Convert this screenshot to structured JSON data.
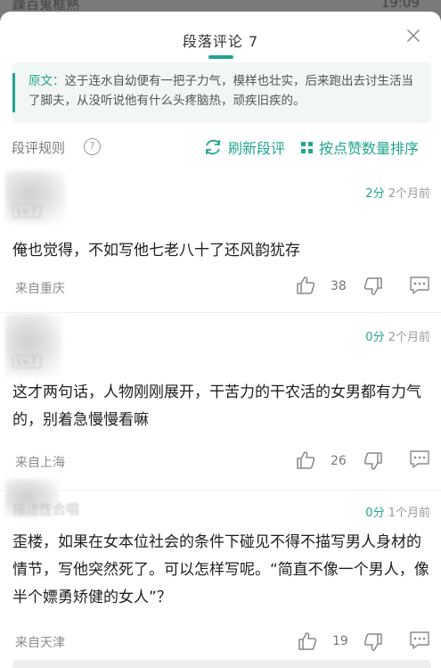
{
  "status_bar": {
    "left_text": "躁百鬼框熟",
    "time": "19:09"
  },
  "header": {
    "title": "段落评论  7",
    "close_label": "×"
  },
  "quote": {
    "label": "原文：",
    "text": "这于连水自幼便有一把子力气，模样也壮实，后来跑出去讨生活当了脚夫，从没听说他有什么头疼脑热，顽疾旧疾的。"
  },
  "toolbar": {
    "rules_label": "段评规则",
    "help_label": "?",
    "refresh_label": "刷新段评",
    "sort_label": "按点赞数量排序"
  },
  "comments": [
    {
      "user": "Lv.7",
      "score": "2分",
      "time": "2个月前",
      "text": "俺也觉得，不如写他七老八十了还风韵犹存",
      "location": "来自重庆",
      "likes": "38"
    },
    {
      "user": "Lv.7",
      "score": "0分",
      "time": "2个月前",
      "text": "这才两句话，人物刚刚展开，干苦力的干农活的女男都有力气的，别着急慢慢看嘛",
      "location": "来自上海",
      "likes": "26"
    },
    {
      "user": "描述性合唱",
      "score": "0分",
      "time": "1个月前",
      "text": "歪楼，如果在女本位社会的条件下碰见不得不描写男人身材的情节，写他突然死了。可以怎样写呢。“简直不像一个男人，像半个嫖勇矫健的女人”？",
      "location": "来自天津",
      "likes": "19"
    }
  ],
  "colors": {
    "accent": "#21a58f",
    "quote_bg": "#f2f6f5",
    "overlay": "#6e6e6e"
  }
}
